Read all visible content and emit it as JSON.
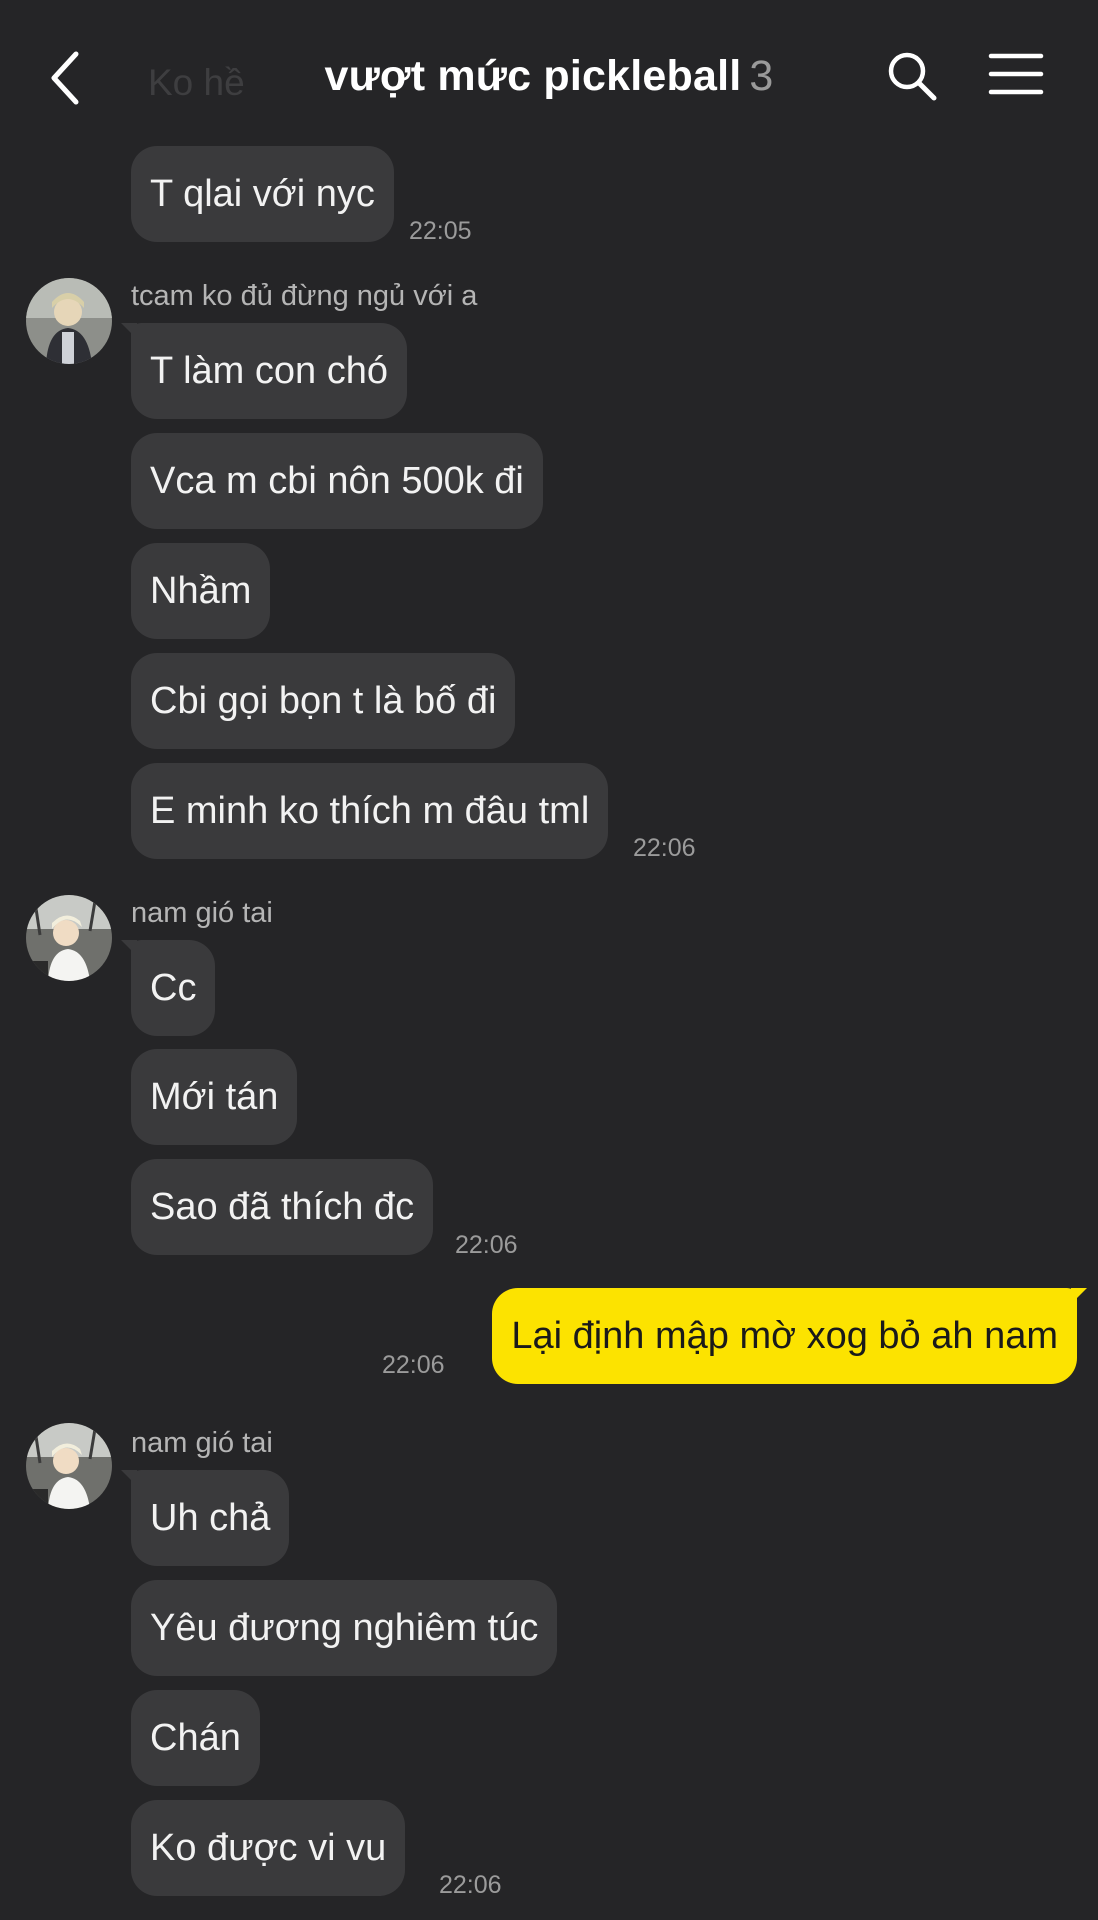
{
  "header": {
    "ghost_text": "Ko hề",
    "title": "vượt mức pickleball",
    "member_count": "3",
    "icons": {
      "back": "chevron-left-icon",
      "search": "search-icon",
      "menu": "hamburger-menu-icon"
    }
  },
  "colors": {
    "background": "#252527",
    "bubble_other": "#3a3a3c",
    "bubble_mine": "#fce300",
    "timestamp": "#9b9b9b"
  },
  "messages": [
    {
      "text": "T qlai với nyc",
      "time": "22:05"
    },
    {
      "sender": "tcam ko đủ đừng ngủ với a",
      "text": "T làm con chó"
    },
    {
      "text": "Vca m cbi nôn 500k đi"
    },
    {
      "text": "Nhầm"
    },
    {
      "text": "Cbi gọi bọn t là bố đi"
    },
    {
      "text": "E minh ko thích m đâu tml",
      "time": "22:06"
    },
    {
      "sender": "nam gió tai",
      "text": "Cc"
    },
    {
      "text": "Mới tán"
    },
    {
      "text": "Sao đã thích đc",
      "time": "22:06"
    },
    {
      "text": "Lại định mập mờ xog bỏ ah nam",
      "time": "22:06",
      "mine": true
    },
    {
      "sender": "nam gió tai",
      "text": "Uh chả"
    },
    {
      "text": "Yêu đương nghiêm túc"
    },
    {
      "text": "Chán"
    },
    {
      "text": "Ko được vi vu",
      "time": "22:06"
    }
  ]
}
